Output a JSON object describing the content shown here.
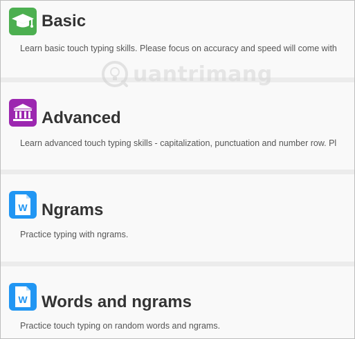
{
  "courses": [
    {
      "title": "Basic",
      "description": "Learn basic touch typing skills. Please focus on accuracy and speed will come with",
      "icon": "graduation-cap-icon",
      "icon_color": "#4caf50"
    },
    {
      "title": "Advanced",
      "description": "Learn advanced touch typing skills - capitalization, punctuation and number row. Pl",
      "icon": "institution-icon",
      "icon_color": "#9c27b0"
    },
    {
      "title": "Ngrams",
      "description": "Practice typing with ngrams.",
      "icon": "word-document-icon",
      "icon_color": "#2196f3"
    },
    {
      "title": "Words and ngrams",
      "description": "Practice touch typing on random words and ngrams.",
      "icon": "word-document-icon",
      "icon_color": "#2196f3"
    }
  ],
  "watermark": {
    "text": "uantrimang",
    "logo": "quantrimang-logo"
  }
}
